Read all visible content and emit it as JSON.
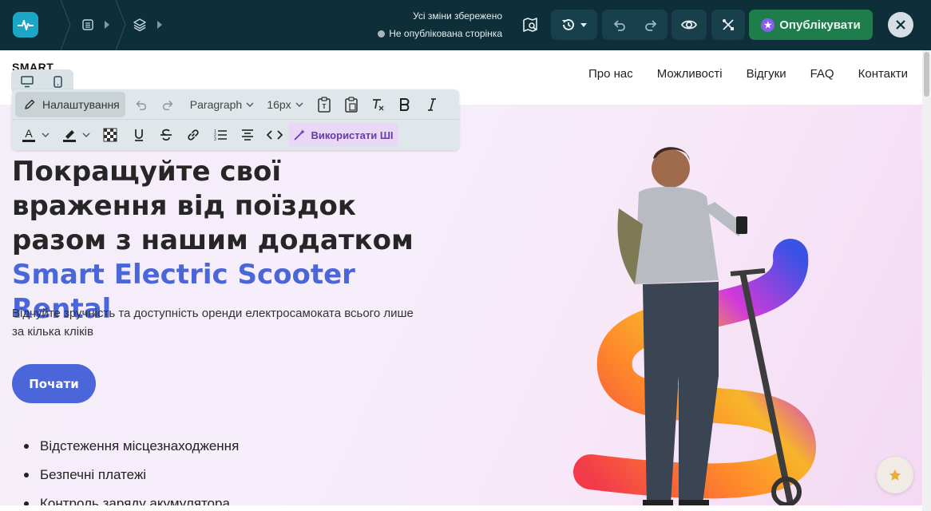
{
  "topbar": {
    "save_status": "Усі зміни збережено",
    "publish_status": "Не опублікована сторінка",
    "publish_label": "Опублікувати",
    "brand_color": "#1aa6c4",
    "publish_color": "#1f7d4b"
  },
  "editor": {
    "device_modes": [
      "desktop-icon",
      "mobile-icon"
    ],
    "settings_label": "Налаштування",
    "block_format": "Paragraph",
    "font_size": "16px",
    "ai_label": "Використати ШІ"
  },
  "site": {
    "brand": "SMART",
    "nav": [
      "Про нас",
      "Можливості",
      "Відгуки",
      "FAQ",
      "Контакти"
    ],
    "hero": {
      "title_plain": "Покращуйте свої враження від поїздок разом з нашим додатком ",
      "title_accent": "Smart Electric Scooter Rental",
      "subtitle": "Відчуйте зручність та доступність оренди електросамоката всього лише за кілька кліків",
      "cta": "Почати",
      "accent_color": "#4a66d8",
      "features": [
        "Відстеження місцезнаходження",
        "Безпечні платежі",
        "Контроль заряду акумулятора"
      ]
    }
  }
}
